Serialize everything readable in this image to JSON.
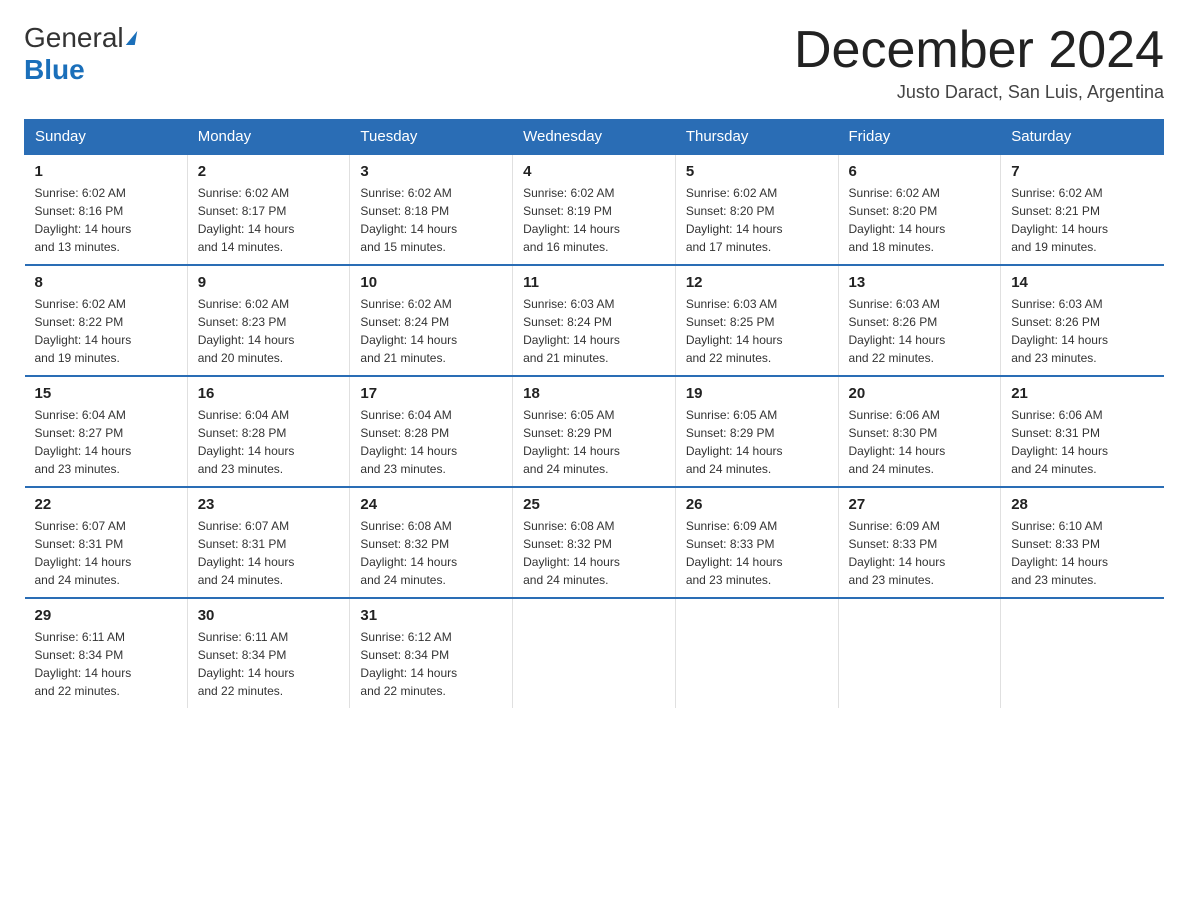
{
  "header": {
    "logo_general": "General",
    "logo_blue": "Blue",
    "month_title": "December 2024",
    "location": "Justo Daract, San Luis, Argentina"
  },
  "days_of_week": [
    "Sunday",
    "Monday",
    "Tuesday",
    "Wednesday",
    "Thursday",
    "Friday",
    "Saturday"
  ],
  "weeks": [
    [
      {
        "day": "1",
        "sunrise": "6:02 AM",
        "sunset": "8:16 PM",
        "daylight": "14 hours and 13 minutes."
      },
      {
        "day": "2",
        "sunrise": "6:02 AM",
        "sunset": "8:17 PM",
        "daylight": "14 hours and 14 minutes."
      },
      {
        "day": "3",
        "sunrise": "6:02 AM",
        "sunset": "8:18 PM",
        "daylight": "14 hours and 15 minutes."
      },
      {
        "day": "4",
        "sunrise": "6:02 AM",
        "sunset": "8:19 PM",
        "daylight": "14 hours and 16 minutes."
      },
      {
        "day": "5",
        "sunrise": "6:02 AM",
        "sunset": "8:20 PM",
        "daylight": "14 hours and 17 minutes."
      },
      {
        "day": "6",
        "sunrise": "6:02 AM",
        "sunset": "8:20 PM",
        "daylight": "14 hours and 18 minutes."
      },
      {
        "day": "7",
        "sunrise": "6:02 AM",
        "sunset": "8:21 PM",
        "daylight": "14 hours and 19 minutes."
      }
    ],
    [
      {
        "day": "8",
        "sunrise": "6:02 AM",
        "sunset": "8:22 PM",
        "daylight": "14 hours and 19 minutes."
      },
      {
        "day": "9",
        "sunrise": "6:02 AM",
        "sunset": "8:23 PM",
        "daylight": "14 hours and 20 minutes."
      },
      {
        "day": "10",
        "sunrise": "6:02 AM",
        "sunset": "8:24 PM",
        "daylight": "14 hours and 21 minutes."
      },
      {
        "day": "11",
        "sunrise": "6:03 AM",
        "sunset": "8:24 PM",
        "daylight": "14 hours and 21 minutes."
      },
      {
        "day": "12",
        "sunrise": "6:03 AM",
        "sunset": "8:25 PM",
        "daylight": "14 hours and 22 minutes."
      },
      {
        "day": "13",
        "sunrise": "6:03 AM",
        "sunset": "8:26 PM",
        "daylight": "14 hours and 22 minutes."
      },
      {
        "day": "14",
        "sunrise": "6:03 AM",
        "sunset": "8:26 PM",
        "daylight": "14 hours and 23 minutes."
      }
    ],
    [
      {
        "day": "15",
        "sunrise": "6:04 AM",
        "sunset": "8:27 PM",
        "daylight": "14 hours and 23 minutes."
      },
      {
        "day": "16",
        "sunrise": "6:04 AM",
        "sunset": "8:28 PM",
        "daylight": "14 hours and 23 minutes."
      },
      {
        "day": "17",
        "sunrise": "6:04 AM",
        "sunset": "8:28 PM",
        "daylight": "14 hours and 23 minutes."
      },
      {
        "day": "18",
        "sunrise": "6:05 AM",
        "sunset": "8:29 PM",
        "daylight": "14 hours and 24 minutes."
      },
      {
        "day": "19",
        "sunrise": "6:05 AM",
        "sunset": "8:29 PM",
        "daylight": "14 hours and 24 minutes."
      },
      {
        "day": "20",
        "sunrise": "6:06 AM",
        "sunset": "8:30 PM",
        "daylight": "14 hours and 24 minutes."
      },
      {
        "day": "21",
        "sunrise": "6:06 AM",
        "sunset": "8:31 PM",
        "daylight": "14 hours and 24 minutes."
      }
    ],
    [
      {
        "day": "22",
        "sunrise": "6:07 AM",
        "sunset": "8:31 PM",
        "daylight": "14 hours and 24 minutes."
      },
      {
        "day": "23",
        "sunrise": "6:07 AM",
        "sunset": "8:31 PM",
        "daylight": "14 hours and 24 minutes."
      },
      {
        "day": "24",
        "sunrise": "6:08 AM",
        "sunset": "8:32 PM",
        "daylight": "14 hours and 24 minutes."
      },
      {
        "day": "25",
        "sunrise": "6:08 AM",
        "sunset": "8:32 PM",
        "daylight": "14 hours and 24 minutes."
      },
      {
        "day": "26",
        "sunrise": "6:09 AM",
        "sunset": "8:33 PM",
        "daylight": "14 hours and 23 minutes."
      },
      {
        "day": "27",
        "sunrise": "6:09 AM",
        "sunset": "8:33 PM",
        "daylight": "14 hours and 23 minutes."
      },
      {
        "day": "28",
        "sunrise": "6:10 AM",
        "sunset": "8:33 PM",
        "daylight": "14 hours and 23 minutes."
      }
    ],
    [
      {
        "day": "29",
        "sunrise": "6:11 AM",
        "sunset": "8:34 PM",
        "daylight": "14 hours and 22 minutes."
      },
      {
        "day": "30",
        "sunrise": "6:11 AM",
        "sunset": "8:34 PM",
        "daylight": "14 hours and 22 minutes."
      },
      {
        "day": "31",
        "sunrise": "6:12 AM",
        "sunset": "8:34 PM",
        "daylight": "14 hours and 22 minutes."
      },
      null,
      null,
      null,
      null
    ]
  ],
  "labels": {
    "sunrise": "Sunrise:",
    "sunset": "Sunset:",
    "daylight": "Daylight:"
  }
}
